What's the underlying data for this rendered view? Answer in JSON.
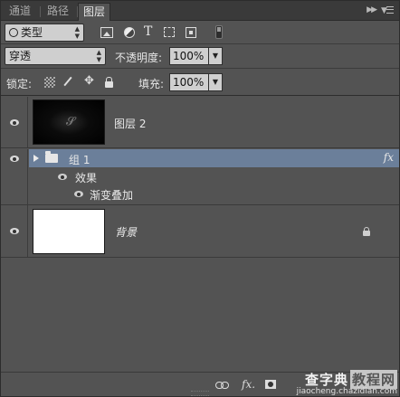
{
  "tabs": [
    {
      "label": "通道",
      "active": false
    },
    {
      "label": "路径",
      "active": false
    },
    {
      "label": "图层",
      "active": true
    }
  ],
  "filter": {
    "kind_label": "类型",
    "icons": [
      "image-filter-icon",
      "adjustment-filter-icon",
      "text-filter-icon",
      "shape-filter-icon",
      "smart-object-filter-icon"
    ],
    "text_icon_glyph": "T"
  },
  "blend": {
    "mode": "穿透",
    "opacity_label": "不透明度:",
    "opacity_value": "100%"
  },
  "lock": {
    "label": "锁定:",
    "fill_label": "填充:",
    "fill_value": "100%"
  },
  "layers": {
    "layer2": {
      "name": "图层 2",
      "visible": true
    },
    "group": {
      "name": "组 1",
      "fx": "fx",
      "effects_label": "效果",
      "effect_item": "渐变叠加",
      "selected_color": "#6b7f9a"
    },
    "background": {
      "name": "背景",
      "locked": true
    }
  },
  "bottom": {
    "fx_label": "fx.",
    "watermark_line1": "查字典",
    "watermark_box": "教程网",
    "watermark_line2": "jiaocheng.chazidian.com"
  }
}
